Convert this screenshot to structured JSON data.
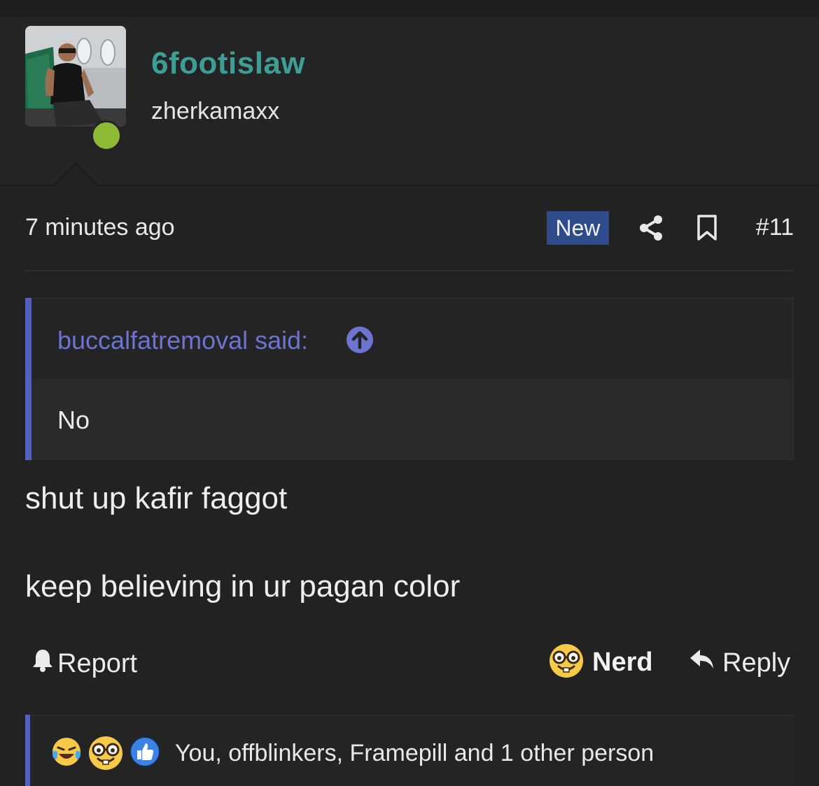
{
  "user": {
    "name": "6footislaw",
    "title": "zherkamaxx",
    "online": true
  },
  "post": {
    "time": "7 minutes ago",
    "badge": "New",
    "number": "#11",
    "icons": [
      "share-icon",
      "bookmark-icon"
    ]
  },
  "quote": {
    "author": "buccalfatremoval said:",
    "body": "No"
  },
  "message": {
    "lines": [
      "shut up kafir faggot",
      "keep believing in ur pagan color"
    ]
  },
  "actions": {
    "report": "Report",
    "react": "Nerd",
    "reply": "Reply"
  },
  "reactions": {
    "icons": [
      "laughing-crying-emoji-icon",
      "nerd-emoji-icon",
      "thumbs-up-icon"
    ],
    "summary": "You, offblinkers, Framepill and 1 other person"
  },
  "colors": {
    "background": "#222223",
    "username": "#3e9e96",
    "badge": "#2e4c8c",
    "quote_accent": "#5660b8",
    "quote_author": "#6c74cf",
    "online": "#8fba36"
  }
}
